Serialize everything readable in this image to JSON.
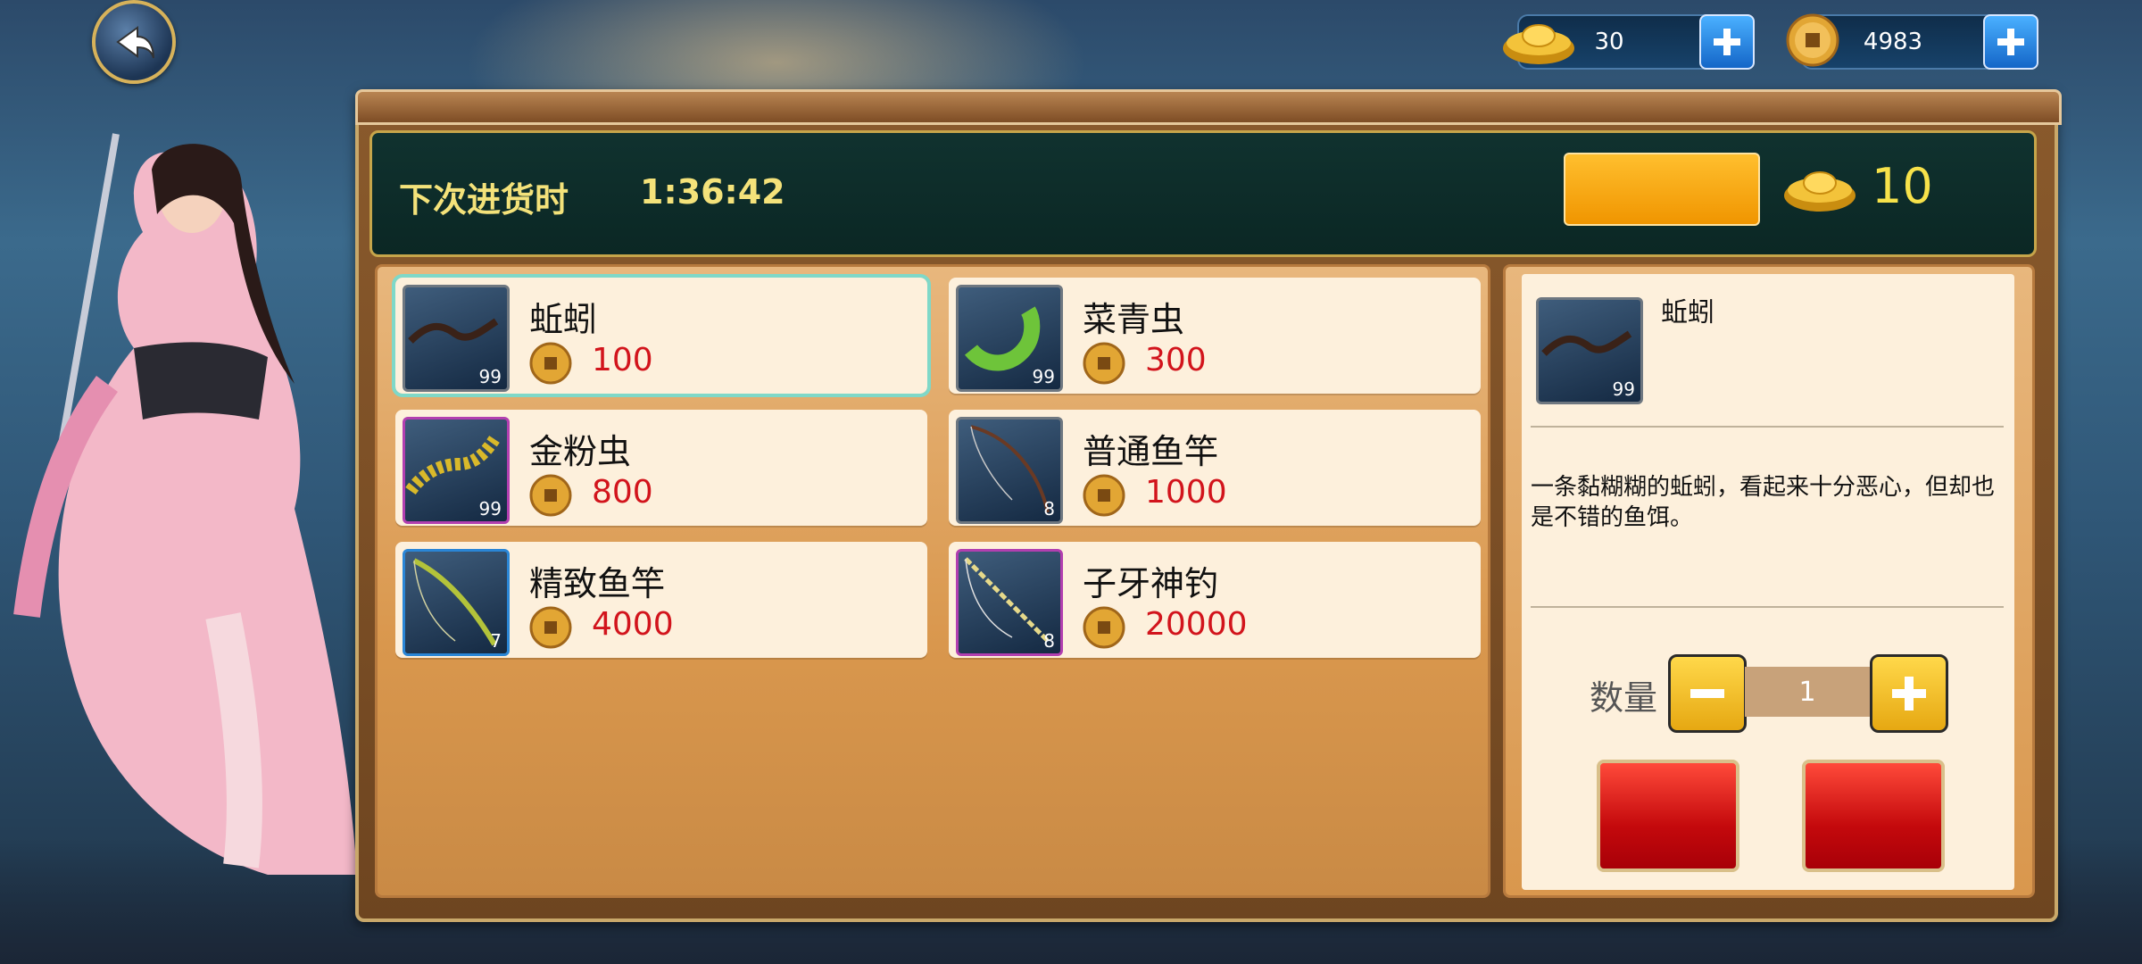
{
  "currency": {
    "gold_ingot": {
      "value": "30",
      "icon": "gold-ingot-icon"
    },
    "copper_coin": {
      "value": "4983",
      "icon": "copper-coin-icon"
    }
  },
  "header": {
    "restock_label": "下次进货时",
    "restock_time": "1:36:42",
    "refresh_cost": "10"
  },
  "shop_items": [
    {
      "name": "蚯蚓",
      "price": "100",
      "qty": "99"
    },
    {
      "name": "菜青虫",
      "price": "300",
      "qty": "99"
    },
    {
      "name": "金粉虫",
      "price": "800",
      "qty": "99"
    },
    {
      "name": "普通鱼竿",
      "price": "1000",
      "qty": "8"
    },
    {
      "name": "精致鱼竿",
      "price": "4000",
      "qty": "7"
    },
    {
      "name": "子牙神钓",
      "price": "20000",
      "qty": "8"
    }
  ],
  "detail": {
    "name": "蚯蚓",
    "qty": "99",
    "description": "一条黏糊糊的蚯蚓，看起来十分恶心，但却也是不错的鱼饵。",
    "quantity_label": "数量",
    "quantity_value": "1"
  },
  "colors": {
    "price": "#d2141c",
    "header_text": "#f4e27a",
    "accent_orange": "#f09500"
  }
}
